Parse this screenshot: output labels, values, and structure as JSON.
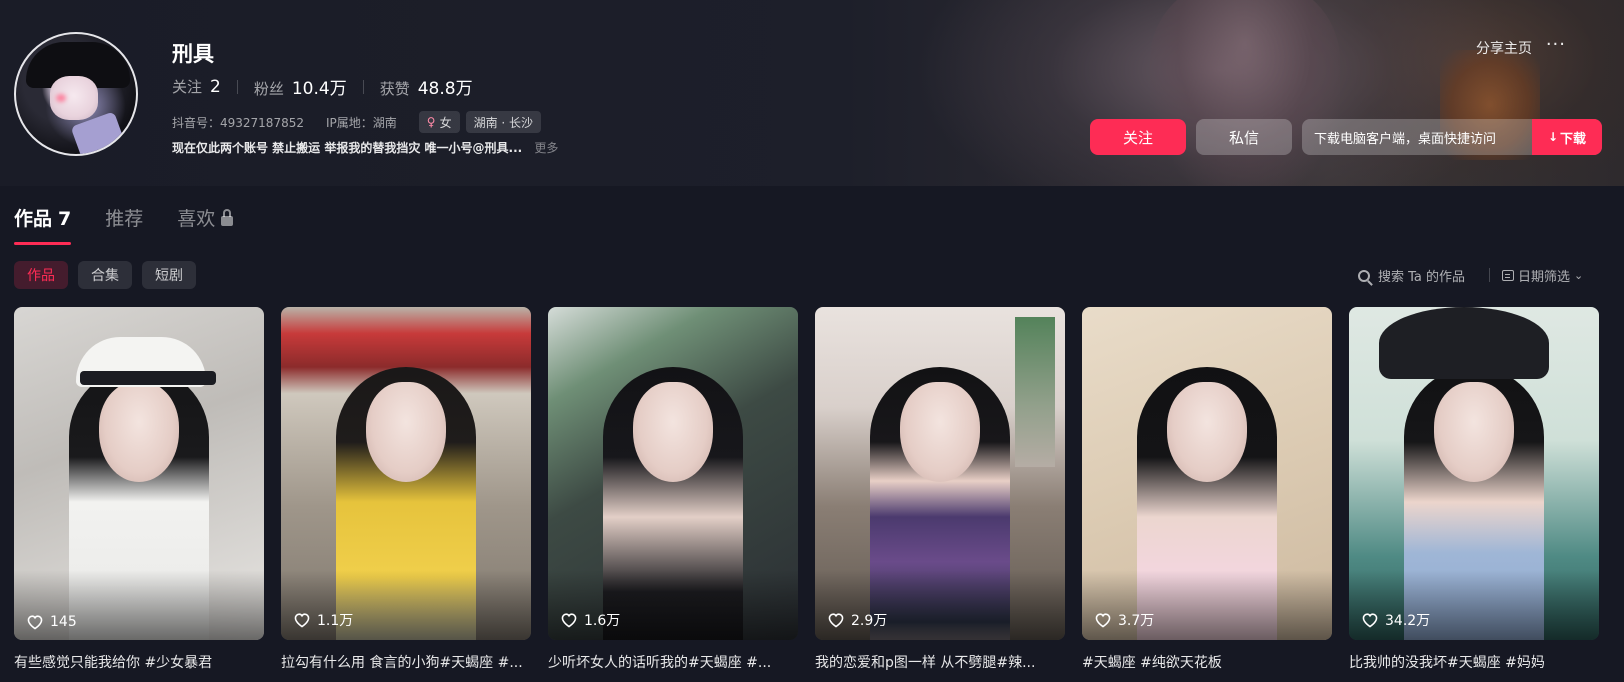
{
  "profile": {
    "username": "刑具",
    "stats": [
      {
        "label": "关注",
        "value": "2"
      },
      {
        "label": "粉丝",
        "value": "10.4万"
      },
      {
        "label": "获赞",
        "value": "48.8万"
      }
    ],
    "douyin_id": "抖音号：49327187852",
    "ip_location": "IP属地：湖南",
    "gender_tag": "女",
    "gender_icon": "female-icon",
    "location_tag": "湖南 · 长沙",
    "bio": "现在仅此两个账号 禁止搬运 举报我的替我挡灾 唯一小号@刑具...",
    "bio_more": "更多"
  },
  "header_actions": {
    "share": "分享主页",
    "more": "···",
    "follow": "关注",
    "message": "私信",
    "download_text": "下载电脑客户端，桌面快捷访问",
    "download_button": "下载"
  },
  "tabs": [
    {
      "label": "作品",
      "count": "7"
    },
    {
      "label": "推荐"
    },
    {
      "label": "喜欢"
    }
  ],
  "filters": {
    "chips": [
      "作品",
      "合集",
      "短剧"
    ],
    "search": "搜索 Ta 的作品",
    "date": "日期筛选"
  },
  "videos": [
    {
      "likes": "145",
      "caption": "有些感觉只能我给你 #少女暴君"
    },
    {
      "likes": "1.1万",
      "caption": "拉勾有什么用 食言的小狗#天蝎座 #..."
    },
    {
      "likes": "1.6万",
      "caption": "少听坏女人的话听我的#天蝎座 #..."
    },
    {
      "likes": "2.9万",
      "caption": "我的恋爱和p图一样 从不劈腿#辣..."
    },
    {
      "likes": "3.7万",
      "caption": "#天蝎座 #纯欲天花板"
    },
    {
      "likes": "34.2万",
      "caption": "比我帅的没我坏#天蝎座 #妈妈"
    }
  ],
  "colors": {
    "accent": "#fe2c55",
    "background": "#161823"
  }
}
